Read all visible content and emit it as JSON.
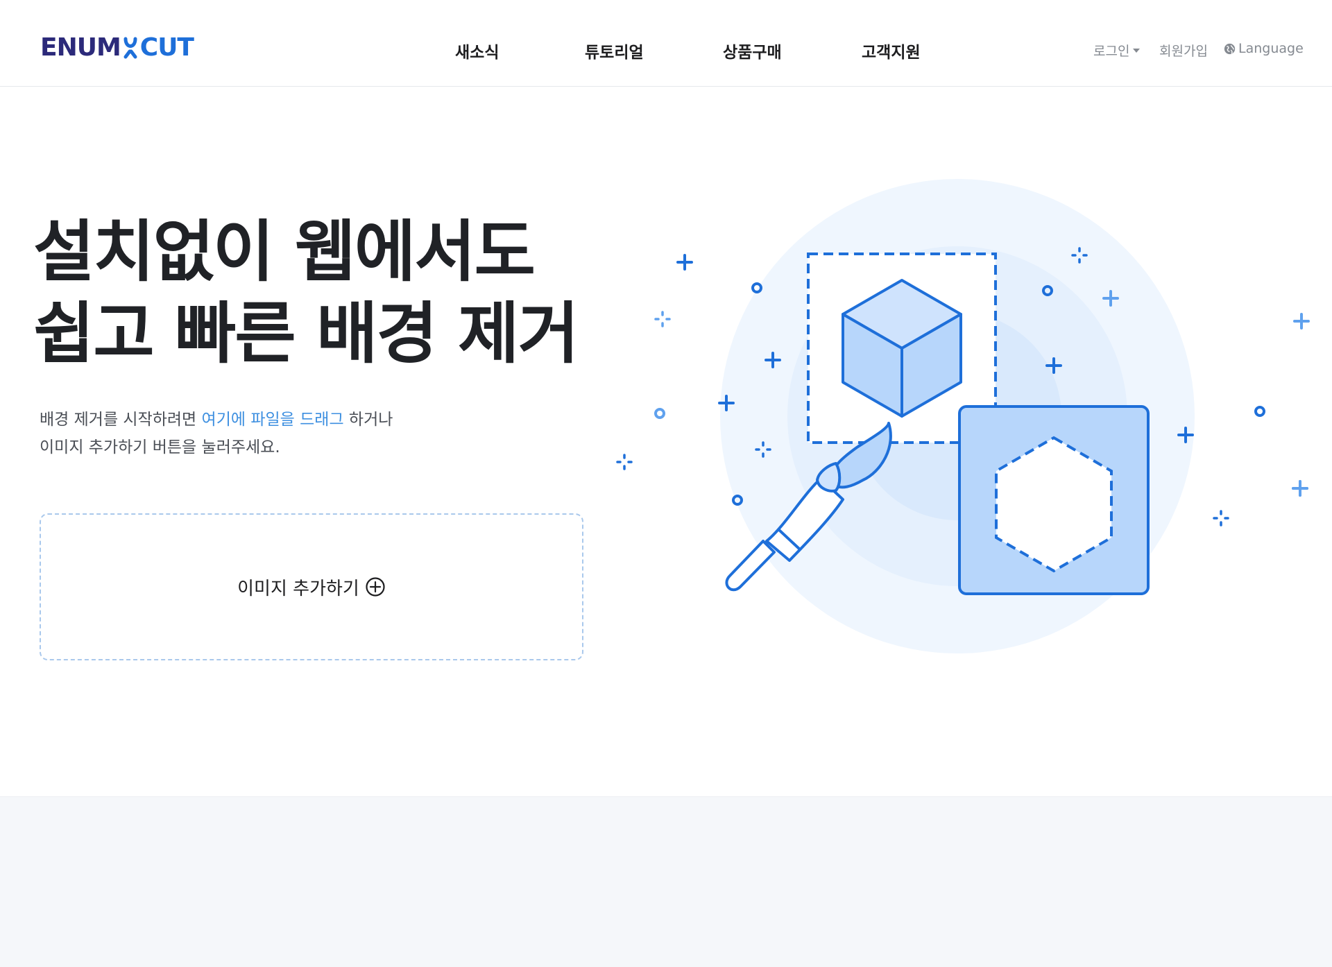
{
  "header": {
    "logo_text_main": "ENUM",
    "logo_text_accent": "CUT",
    "nav": [
      "새소식",
      "튜토리얼",
      "상품구매",
      "고객지원"
    ],
    "login": "로그인",
    "signup": "회원가입",
    "language": "Language"
  },
  "hero": {
    "title_line1": "설치없이 웹에서도",
    "title_line2": "쉽고 빠른 배경 제거",
    "desc_part1": "배경 제거를 시작하려면 ",
    "desc_highlight": "여기에 파일을 드래그",
    "desc_part2": " 하거나",
    "desc_line2": "이미지 추가하기 버튼을 눌러주세요.",
    "add_image_label": "이미지 추가하기"
  },
  "colors": {
    "brand_navy": "#2c2a7a",
    "brand_blue": "#1e6fd9",
    "highlight": "#3d8fe0",
    "dropzone_border": "#a9c8ec",
    "illustration_fill": "#b7d6fb"
  },
  "icons": [
    "scissors-icon",
    "globe-icon",
    "caret-down-icon",
    "plus-circle-icon",
    "cube-icon",
    "hexagon-icon",
    "brush-icon"
  ]
}
